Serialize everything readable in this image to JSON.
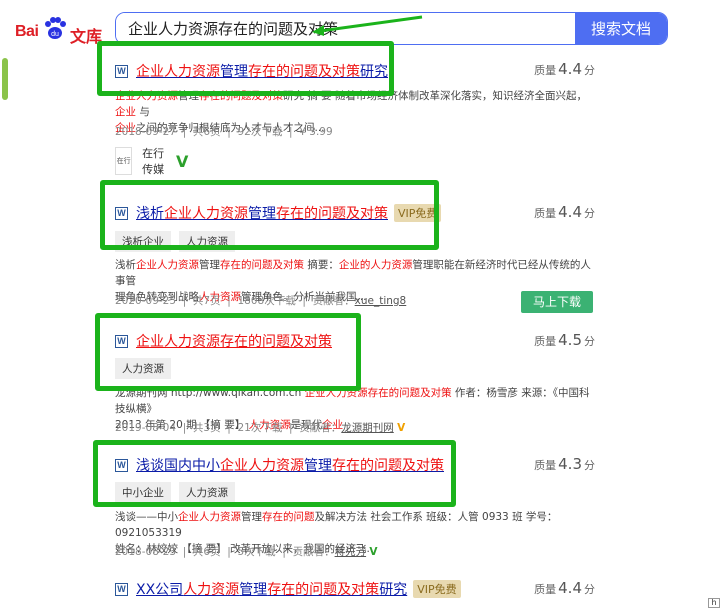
{
  "brand": {
    "bai": "Bai",
    "wk": "文库"
  },
  "search": {
    "value": "企业人力资源存在的问题及对策",
    "button": "搜索文档"
  },
  "results": [
    {
      "title_pre": "企业人力资源",
      "title_mid": "管理",
      "title_post": "存在的问题及对策",
      "title_tail": "研究",
      "score_label": "质量",
      "score": "4.4",
      "score_unit": "分",
      "snippet_a": "企业人力资源",
      "snippet_b": "管理",
      "snippet_c": "存在的问题及对策",
      "snippet_d": "研究 摘 要 随着市场经济体制改革深化落实，知识经济全面兴起，",
      "snippet_e": "企业",
      "snippet_f": " 与",
      "snippet2_a": "企业",
      "snippet2_b": "之间的竞争归根结底为人才与人才之间...",
      "date": "2018-09-27",
      "pages": "共6页",
      "downloads": "92次下载",
      "price": "¥ 3.99",
      "publisher": "在行传媒"
    },
    {
      "title_pre": "浅析",
      "title_red": "企业人力资源",
      "title_mid": "管理",
      "title_post": "存在的问题及对策",
      "vip": "VIP免费",
      "score_label": "质量",
      "score": "4.4",
      "score_unit": "分",
      "tags": [
        "浅析企业",
        "人力资源"
      ],
      "snippet_a": "浅析",
      "snippet_b": "企业人力资源",
      "snippet_c": "管理",
      "snippet_d": "存在的问题及对策",
      "snippet_e": " 摘要：",
      "snippet_f": "企业的人力资源",
      "snippet_g": "管理职能在新经济时代已经从传统的人事管",
      "snippet2_a": "理角色转变到战略",
      "snippet2_b": "人力资源",
      "snippet2_c": "管理角色。分析当前我国...",
      "date": "2020-09-25",
      "pages": "共7页",
      "downloads": "1808次下载",
      "contrib_label": "贡献者：",
      "contrib": "xue_ting8",
      "download_btn": "马上下载"
    },
    {
      "title": "企业人力资源存在的问题及对策",
      "score_label": "质量",
      "score": "4.5",
      "score_unit": "分",
      "tags": [
        "人力资源"
      ],
      "snippet_a": "龙源期刊网 http://www.qikan.com.cn ",
      "snippet_b": "企业人力资源存在的问题及对策",
      "snippet_c": " 作者：杨雪彦 来源：《中国科技纵横》",
      "snippet2_a": "2013 年第 20 期 【摘 要】 ",
      "snippet2_b": "人力资源",
      "snippet2_c": "是现代",
      "snippet2_d": "企业",
      "date": "2019-08-04",
      "pages": "共3页",
      "downloads": "21次下载",
      "contrib_label": "贡献者：",
      "contrib": "龙源期刊网"
    },
    {
      "title_pre": "浅谈国内中小",
      "title_red": "企业人力资源",
      "title_mid": "管理",
      "title_post": "存在的问题及对策",
      "score_label": "质量",
      "score": "4.3",
      "score_unit": "分",
      "tags": [
        "中小企业",
        "人力资源"
      ],
      "snippet_a": "浅谈——中小",
      "snippet_b": "企业人力资源",
      "snippet_c": "管理",
      "snippet_d": "存在的问题",
      "snippet_e": "及解决方法 社会工作系 班级：人管 0933 班 学号：0921053319",
      "snippet2_a": "姓名：林姣姣 【摘 要】 改革开放以来，我国的经济飞...",
      "date": "2018-08-23",
      "pages": "共6页",
      "downloads": "5次下载",
      "contrib_label": "贡献者：",
      "contrib": "蒋先芳"
    },
    {
      "title_pre": "XX公司",
      "title_red": "人力资源",
      "title_mid": "管理",
      "title_post": "存在的问题及对策",
      "title_tail": "研究",
      "vip": "VIP免费",
      "score_label": "质量",
      "score": "4.4",
      "score_unit": "分"
    }
  ],
  "colors": {
    "accent": "#4e6ef2",
    "highlight": "#1bb31b",
    "keyword": "#e11111",
    "link": "#0b1ca8"
  }
}
